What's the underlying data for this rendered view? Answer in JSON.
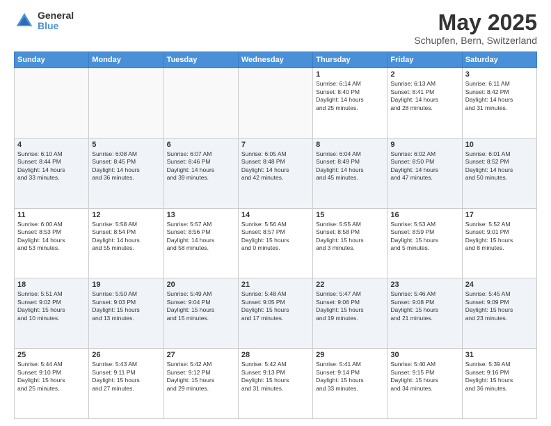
{
  "logo": {
    "general": "General",
    "blue": "Blue"
  },
  "header": {
    "month": "May 2025",
    "location": "Schupfen, Bern, Switzerland"
  },
  "weekdays": [
    "Sunday",
    "Monday",
    "Tuesday",
    "Wednesday",
    "Thursday",
    "Friday",
    "Saturday"
  ],
  "weeks": [
    [
      {
        "day": "",
        "info": ""
      },
      {
        "day": "",
        "info": ""
      },
      {
        "day": "",
        "info": ""
      },
      {
        "day": "",
        "info": ""
      },
      {
        "day": "1",
        "info": "Sunrise: 6:14 AM\nSunset: 8:40 PM\nDaylight: 14 hours\nand 25 minutes."
      },
      {
        "day": "2",
        "info": "Sunrise: 6:13 AM\nSunset: 8:41 PM\nDaylight: 14 hours\nand 28 minutes."
      },
      {
        "day": "3",
        "info": "Sunrise: 6:11 AM\nSunset: 8:42 PM\nDaylight: 14 hours\nand 31 minutes."
      }
    ],
    [
      {
        "day": "4",
        "info": "Sunrise: 6:10 AM\nSunset: 8:44 PM\nDaylight: 14 hours\nand 33 minutes."
      },
      {
        "day": "5",
        "info": "Sunrise: 6:08 AM\nSunset: 8:45 PM\nDaylight: 14 hours\nand 36 minutes."
      },
      {
        "day": "6",
        "info": "Sunrise: 6:07 AM\nSunset: 8:46 PM\nDaylight: 14 hours\nand 39 minutes."
      },
      {
        "day": "7",
        "info": "Sunrise: 6:05 AM\nSunset: 8:48 PM\nDaylight: 14 hours\nand 42 minutes."
      },
      {
        "day": "8",
        "info": "Sunrise: 6:04 AM\nSunset: 8:49 PM\nDaylight: 14 hours\nand 45 minutes."
      },
      {
        "day": "9",
        "info": "Sunrise: 6:02 AM\nSunset: 8:50 PM\nDaylight: 14 hours\nand 47 minutes."
      },
      {
        "day": "10",
        "info": "Sunrise: 6:01 AM\nSunset: 8:52 PM\nDaylight: 14 hours\nand 50 minutes."
      }
    ],
    [
      {
        "day": "11",
        "info": "Sunrise: 6:00 AM\nSunset: 8:53 PM\nDaylight: 14 hours\nand 53 minutes."
      },
      {
        "day": "12",
        "info": "Sunrise: 5:58 AM\nSunset: 8:54 PM\nDaylight: 14 hours\nand 55 minutes."
      },
      {
        "day": "13",
        "info": "Sunrise: 5:57 AM\nSunset: 8:56 PM\nDaylight: 14 hours\nand 58 minutes."
      },
      {
        "day": "14",
        "info": "Sunrise: 5:56 AM\nSunset: 8:57 PM\nDaylight: 15 hours\nand 0 minutes."
      },
      {
        "day": "15",
        "info": "Sunrise: 5:55 AM\nSunset: 8:58 PM\nDaylight: 15 hours\nand 3 minutes."
      },
      {
        "day": "16",
        "info": "Sunrise: 5:53 AM\nSunset: 8:59 PM\nDaylight: 15 hours\nand 5 minutes."
      },
      {
        "day": "17",
        "info": "Sunrise: 5:52 AM\nSunset: 9:01 PM\nDaylight: 15 hours\nand 8 minutes."
      }
    ],
    [
      {
        "day": "18",
        "info": "Sunrise: 5:51 AM\nSunset: 9:02 PM\nDaylight: 15 hours\nand 10 minutes."
      },
      {
        "day": "19",
        "info": "Sunrise: 5:50 AM\nSunset: 9:03 PM\nDaylight: 15 hours\nand 13 minutes."
      },
      {
        "day": "20",
        "info": "Sunrise: 5:49 AM\nSunset: 9:04 PM\nDaylight: 15 hours\nand 15 minutes."
      },
      {
        "day": "21",
        "info": "Sunrise: 5:48 AM\nSunset: 9:05 PM\nDaylight: 15 hours\nand 17 minutes."
      },
      {
        "day": "22",
        "info": "Sunrise: 5:47 AM\nSunset: 9:06 PM\nDaylight: 15 hours\nand 19 minutes."
      },
      {
        "day": "23",
        "info": "Sunrise: 5:46 AM\nSunset: 9:08 PM\nDaylight: 15 hours\nand 21 minutes."
      },
      {
        "day": "24",
        "info": "Sunrise: 5:45 AM\nSunset: 9:09 PM\nDaylight: 15 hours\nand 23 minutes."
      }
    ],
    [
      {
        "day": "25",
        "info": "Sunrise: 5:44 AM\nSunset: 9:10 PM\nDaylight: 15 hours\nand 25 minutes."
      },
      {
        "day": "26",
        "info": "Sunrise: 5:43 AM\nSunset: 9:11 PM\nDaylight: 15 hours\nand 27 minutes."
      },
      {
        "day": "27",
        "info": "Sunrise: 5:42 AM\nSunset: 9:12 PM\nDaylight: 15 hours\nand 29 minutes."
      },
      {
        "day": "28",
        "info": "Sunrise: 5:42 AM\nSunset: 9:13 PM\nDaylight: 15 hours\nand 31 minutes."
      },
      {
        "day": "29",
        "info": "Sunrise: 5:41 AM\nSunset: 9:14 PM\nDaylight: 15 hours\nand 33 minutes."
      },
      {
        "day": "30",
        "info": "Sunrise: 5:40 AM\nSunset: 9:15 PM\nDaylight: 15 hours\nand 34 minutes."
      },
      {
        "day": "31",
        "info": "Sunrise: 5:39 AM\nSunset: 9:16 PM\nDaylight: 15 hours\nand 36 minutes."
      }
    ]
  ]
}
